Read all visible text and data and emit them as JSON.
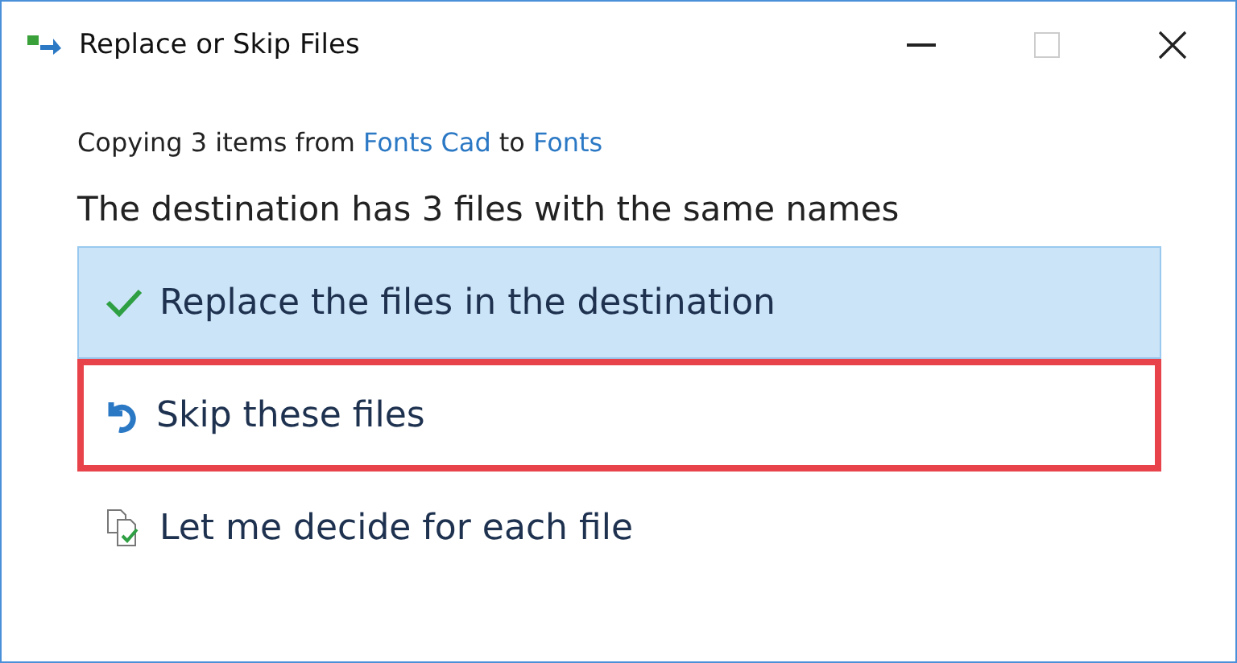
{
  "window": {
    "title": "Replace or Skip Files"
  },
  "summary": [
    {
      "kind": "text",
      "text": "Copying 3 items from"
    },
    {
      "kind": "link",
      "text": "Fonts Cad"
    },
    {
      "kind": "text",
      "text": "to"
    },
    {
      "kind": "link",
      "text": "Fonts"
    }
  ],
  "heading": "The destination has 3 files with the same names",
  "options": [
    {
      "kind": "replace",
      "label": "Replace the files in the destination",
      "selected": true,
      "outlined": false
    },
    {
      "kind": "skip",
      "label": "Skip these files",
      "selected": false,
      "outlined": true
    },
    {
      "kind": "decide",
      "label": "Let me decide for each file",
      "selected": false,
      "outlined": false
    }
  ]
}
